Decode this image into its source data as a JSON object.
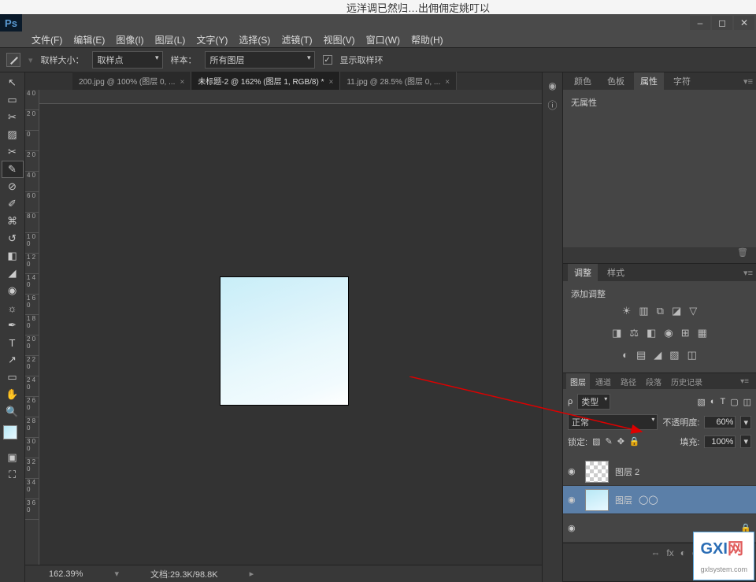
{
  "top_fragment": "远洋调已然归…出佣佣定姚叮以",
  "menubar": {
    "file": "文件(F)",
    "edit": "编辑(E)",
    "image": "图像(I)",
    "layer": "图层(L)",
    "type": "文字(Y)",
    "select": "选择(S)",
    "filter": "滤镜(T)",
    "view": "视图(V)",
    "window": "窗口(W)",
    "help": "帮助(H)"
  },
  "optionbar": {
    "sample_size_label": "取样大小：",
    "sample_size_value": "取样点",
    "sample_label": "样本：",
    "sample_value": "所有图层",
    "show_ring": "显示取样环"
  },
  "tabs": [
    {
      "label": "200.jpg @ 100% (图层 0, ...",
      "active": false
    },
    {
      "label": "未标题-2 @ 162% (图层 1, RGB/8) *",
      "active": true
    },
    {
      "label": "11.jpg @ 28.5% (图层 0, ...",
      "active": false
    }
  ],
  "ruler_marks": [
    "4 0",
    "2 0",
    "0",
    "2 0",
    "4 0",
    "6 0",
    "8 0",
    "1 0 0",
    "1 2 0",
    "1 4 0",
    "1 6 0",
    "1 8 0",
    "2 0 0",
    "2 2 0",
    "2 4 0",
    "2 6 0",
    "2 8 0",
    "3 0 0",
    "3 2 0",
    "3 4 0",
    "3 6 0"
  ],
  "status": {
    "zoom": "162.39%",
    "doc": "文档:29.3K/98.8K"
  },
  "panels": {
    "prop_tabs": {
      "color": "颜色",
      "swatch": "色板",
      "props": "属性",
      "char": "字符"
    },
    "no_props": "无属性",
    "adjust_tabs": {
      "adjust": "调整",
      "style": "样式"
    },
    "add_adjust": "添加调整",
    "layer_tabs": {
      "layer": "图层",
      "channel": "通道",
      "path": "路径",
      "para": "段落",
      "history": "历史记录"
    },
    "kind_label": "类型",
    "mode_label": "正常",
    "opacity_label": "不透明度:",
    "opacity_value": "60%",
    "lock_label": "锁定:",
    "fill_label": "填充:",
    "fill_value": "100%",
    "layers": [
      {
        "name": "图层 2",
        "selected": false,
        "thumb": "chk2"
      },
      {
        "name": "图层",
        "selected": true,
        "thumb": "sky"
      }
    ]
  },
  "watermark": {
    "main": "GXI",
    "sub": "gxlsystem.com",
    "suffix": "网"
  }
}
